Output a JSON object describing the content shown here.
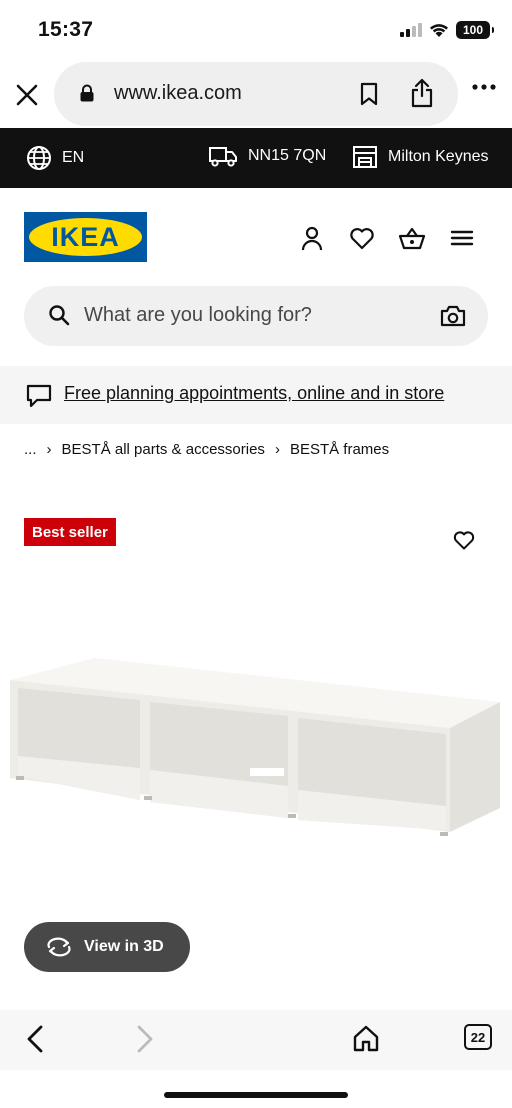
{
  "status": {
    "time": "15:37",
    "battery": "100"
  },
  "browser": {
    "url": "www.ikea.com"
  },
  "utility": {
    "language": "EN",
    "postcode": "NN15 7QN",
    "store": "Milton Keynes"
  },
  "header": {
    "logo": "IKEA"
  },
  "search": {
    "placeholder": "What are you looking for?"
  },
  "promo": {
    "link": "Free planning appointments, online and in store"
  },
  "breadcrumb": {
    "items": [
      "...",
      "BESTÅ all parts & accessories",
      "BESTÅ frames"
    ]
  },
  "product": {
    "badge": "Best seller",
    "view3d_label": "View in 3D"
  },
  "toolbar": {
    "tab_count": "22"
  },
  "colors": {
    "badge": "#cc0008",
    "logo_blue": "#0058a3",
    "logo_yellow": "#ffdb00",
    "utility_bar": "#111111"
  }
}
